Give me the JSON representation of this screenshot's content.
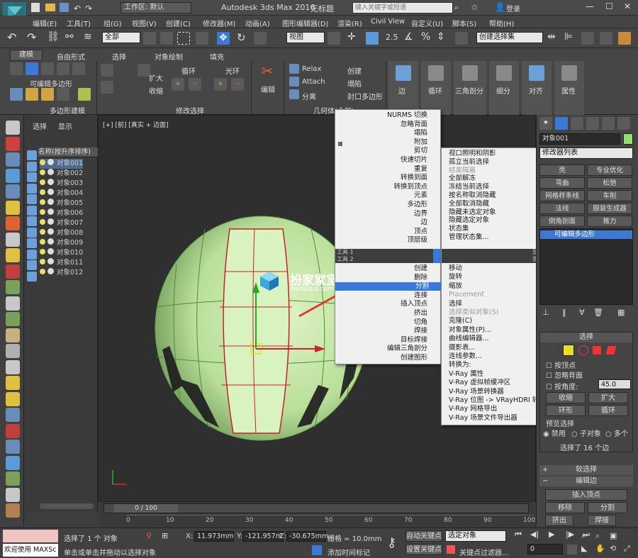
{
  "title_bar": {
    "app_title": "Autodesk 3ds Max 2016",
    "doc_title": "无标题",
    "workspace": "工作区: 默认",
    "search_placeholder": "键入关键字或短语",
    "login": "登录"
  },
  "menubar": [
    "编辑(E)",
    "工具(T)",
    "组(G)",
    "视图(V)",
    "创建(C)",
    "修改器(M)",
    "动画(A)",
    "图形编辑器(D)",
    "渲染(R)",
    "Civil View",
    "自定义(U)",
    "脚本(S)",
    "帮助(H)"
  ],
  "toolbar": {
    "selection_filter": "全部",
    "ref_coord": "视图",
    "snap_value": "2.5",
    "named_selection": "创建选择集"
  },
  "ribbon": {
    "tabs": [
      "建模",
      "自由形式",
      "选择",
      "对象绘制",
      "填充"
    ],
    "panel_poly": "多边形建模",
    "poly_label": "可编辑多边形",
    "modify_sel": "修改选择",
    "grow": "扩大",
    "shrink": "收缩",
    "loop": "循环",
    "ring": "光环",
    "edit": "编辑",
    "relax": "Relax",
    "attach": "Attach",
    "detach": "分离",
    "create": "创建",
    "collapse": "塌陷",
    "cap": "封口多边形",
    "geometry": "几何体(全部)",
    "edge": "边",
    "loop2": "循环",
    "tri": "三角剖分",
    "subdiv": "细分",
    "align": "对齐",
    "props": "属性"
  },
  "scene_explorer": {
    "tabs": [
      "选择",
      "显示"
    ],
    "header": "名称(按升序排序)",
    "items": [
      "对象001",
      "对象002",
      "对象003",
      "对象004",
      "对象005",
      "对象006",
      "对象007",
      "对象008",
      "对象009",
      "对象010",
      "对象011",
      "对象012"
    ]
  },
  "viewport": {
    "label": "[+] [前] [真实 + 边面]",
    "watermark_cn": "扮家家室内设计",
    "watermark_url": "banjiajia.com"
  },
  "quad_menu_left": {
    "items": [
      "NURMS 切换",
      "忽略背面",
      "塌陷",
      "附加",
      "剪切",
      "快速切片",
      "重复",
      "转换到面",
      "转换到顶点",
      "元素",
      "多边形",
      "边界",
      "边",
      "顶点",
      "顶层级"
    ],
    "tool1": "工具 1",
    "tool1_right": "显示",
    "tool2": "工具 2",
    "tool2_right": "变换",
    "items2": [
      "创建",
      "删除",
      "分割",
      "连接",
      "插入顶点",
      "挤出",
      "切角",
      "焊接",
      "目标焊接",
      "编辑三角剖分",
      "创建图形"
    ],
    "highlighted": "分割"
  },
  "quad_menu_right": {
    "items": [
      "视口照明和阴影",
      "孤立当前选择",
      "结束隔离",
      "全部解冻",
      "冻结当前选择",
      "按名称取消隐藏",
      "全部取消隐藏",
      "隐藏未选定对象",
      "隐藏选定对象",
      "状态集",
      "管理状态集..."
    ],
    "items2": [
      "移动",
      "旋转",
      "缩放",
      "Placement",
      "选择",
      "选择类似对象(S)",
      "克隆(C)",
      "对象属性(P)...",
      "曲线编辑器...",
      "摄影表...",
      "连线参数...",
      "转换为:",
      "V-Ray 属性",
      "V-Ray 虚拟帧缓冲区",
      "V-Ray 场景转换器",
      "V-Ray 位图 -> VRayHDRI 转换器",
      "V-Ray 网格导出",
      "V-Ray 场景文件导出器"
    ]
  },
  "command_panel": {
    "object_name": "对象001",
    "modifier_list": "修改器列表",
    "mod_buttons": [
      "壳",
      "专业优化",
      "弯曲",
      "松弛",
      "网格样条线",
      "车削",
      "法线",
      "服装生成器",
      "倒角剖面",
      "推力"
    ],
    "stack_item": "可编辑多边形",
    "selection_title": "选择",
    "by_vertex": "按顶点",
    "ignore_back": "忽略背面",
    "by_angle": "按角度:",
    "angle_value": "45.0",
    "shrink": "收缩",
    "grow": "扩大",
    "ring": "环形",
    "loop": "循环",
    "preview": "预览选择",
    "disabled": "禁用",
    "subobject": "子对象",
    "multi": "多个",
    "selected_status": "选择了 16 个边",
    "soft_sel": "软选择",
    "edit_edges": "编辑边",
    "insert_vertex": "插入顶点",
    "remove": "移除",
    "split": "分割",
    "extrude": "挤出",
    "weld": "焊接"
  },
  "timeline": {
    "frame": "0 / 100",
    "ticks": [
      "0",
      "10",
      "20",
      "30",
      "40",
      "50",
      "60",
      "70",
      "80",
      "90",
      "100"
    ]
  },
  "status": {
    "welcome": "欢迎使用 MAXSc",
    "selected": "选择了 1 个 对象",
    "hint": "单击或单击并拖动以选择对象",
    "x": "11.973mm",
    "y": "-121.957m",
    "z": "-30.675mm",
    "grid": "栅格 = 10.0mm",
    "add_time": "添加时间标记",
    "auto_key": "自动关键点",
    "set_key": "设置关键点",
    "selected_obj": "选定对象",
    "key_filter": "关键点过滤器...",
    "frame_val": "0"
  }
}
